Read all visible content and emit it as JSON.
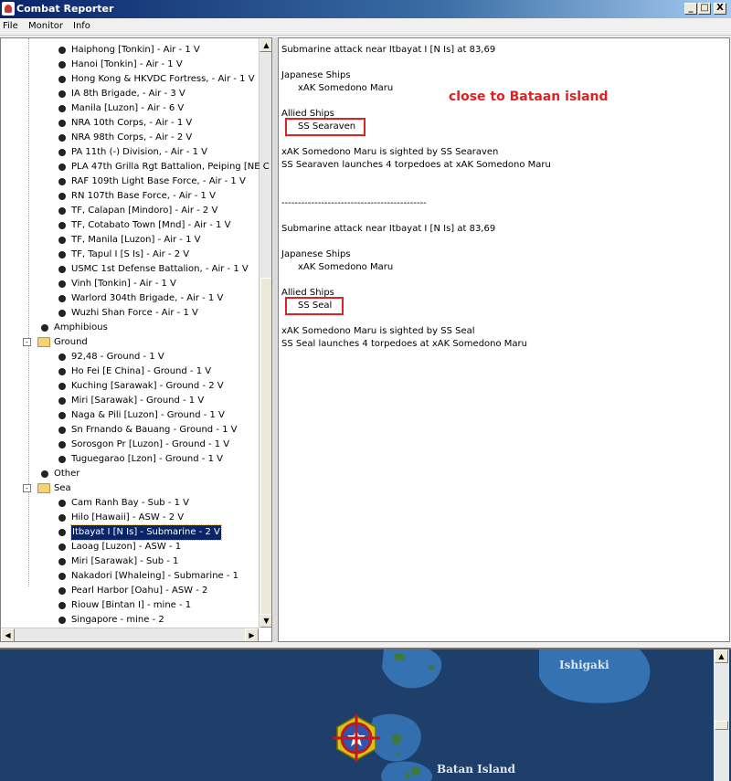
{
  "window": {
    "title": "Combat Reporter",
    "min_glyph": "_",
    "max_glyph": "□",
    "close_glyph": "X"
  },
  "menu": {
    "items": [
      "File",
      "Monitor",
      "Info"
    ]
  },
  "tree": {
    "air_items": [
      "Haiphong [Tonkin]  - Air - 1 V",
      "Hanoi [Tonkin]  - Air - 1 V",
      "Hong Kong & HKVDC Fortress,  - Air - 1 V",
      "IA 8th Brigade,  - Air - 3 V",
      "Manila [Luzon]  - Air - 6 V",
      "NRA 10th Corps,  - Air - 1 V",
      "NRA 98th Corps,  - Air - 2 V",
      "PA 11th (-) Division,  - Air - 1 V",
      "PLA 47th Grilla Rgt Battalion, Peiping [NE C",
      "RAF 109th Light Base Force,  - Air - 1 V",
      "RN 107th Base Force,  - Air - 1 V",
      "TF, Calapan [Mindoro]  - Air - 2 V",
      "TF, Cotabato Town [Mnd]  - Air - 1 V",
      "TF, Manila [Luzon]  - Air - 1 V",
      "TF, Tapul I [S Is]  - Air - 2 V",
      "USMC 1st Defense Battalion,  - Air - 1 V",
      "Vinh [Tonkin]  - Air - 1 V",
      "Warlord 304th Brigade,  - Air - 1 V",
      "Wuzhi Shan Force  - Air - 1 V"
    ],
    "amphibious_label": "Amphibious",
    "ground_label": "Ground",
    "ground_items": [
      "92,48 - Ground - 1 V",
      "Ho Fei [E China]  - Ground - 1 V",
      "Kuching [Sarawak]  - Ground - 2 V",
      "Miri [Sarawak]  - Ground - 1 V",
      "Naga & Pili [Luzon]  - Ground - 1 V",
      "Sn Frnando & Bauang  - Ground - 1 V",
      "Sorosgon Pr [Luzon]  - Ground - 1 V",
      "Tuguegarao [Lzon]  - Ground - 1 V"
    ],
    "other_label": "Other",
    "sea_label": "Sea",
    "sea_items": [
      "Cam Ranh Bay  - Sub - 1 V",
      "Hilo [Hawaii]  - ASW - 2 V",
      "Itbayat I [N Is]  - Submarine - 2 V",
      "Laoag [Luzon]  - ASW - 1",
      "Miri [Sarawak]  - Sub - 1",
      "Nakadori [Whaleing]  - Submarine - 1",
      "Pearl Harbor [Oahu]  - ASW - 2",
      "Riouw [Bintan I]  - mine - 1",
      "Singapore  - mine - 2"
    ],
    "selected_sea_index": 2
  },
  "report": {
    "annotation": "close to Bataan island",
    "lines": [
      "Submarine attack near Itbayat I [N Is]  at 83,69",
      "Japanese Ships",
      "xAK Somedono Maru",
      "Allied Ships",
      "SS Searaven",
      "xAK Somedono Maru is sighted by SS Searaven",
      "SS Searaven launches 4 torpedoes at xAK Somedono Maru",
      "--------------------------------------------",
      "Submarine attack near Itbayat I [N Is]  at 83,69",
      "Japanese Ships",
      "xAK Somedono Maru",
      "Allied Ships",
      "SS Seal",
      "xAK Somedono Maru is sighted by SS Seal",
      "SS Seal launches 4 torpedoes at xAK Somedono Maru"
    ]
  },
  "map": {
    "labels": [
      "Ishigaki",
      "Batan Island"
    ]
  },
  "colors": {
    "highlight": "#dd2222",
    "selection": "#0a246a",
    "sea": "#1f3f6b",
    "land": "#3d7a3a"
  }
}
